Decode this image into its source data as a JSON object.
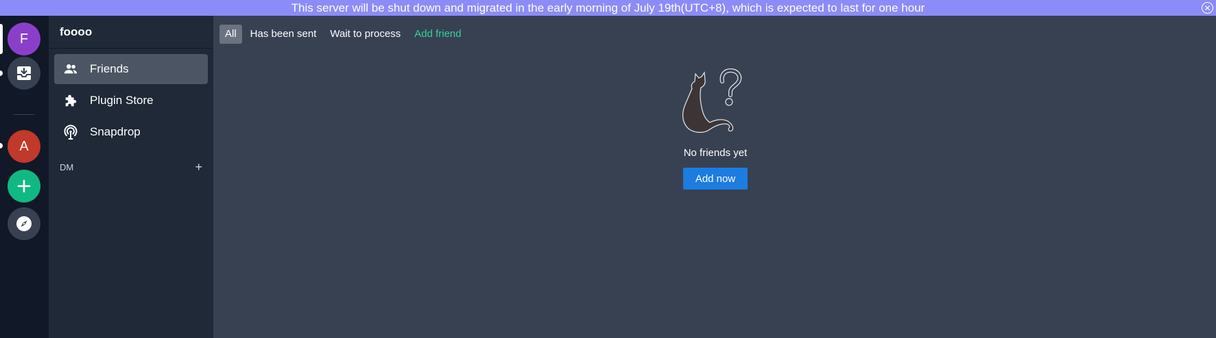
{
  "banner": {
    "message": "This server will be shut down and migrated in the early morning of July 19th(UTC+8), which is expected to last for one hour",
    "close_symbol": "✕"
  },
  "rail": {
    "servers": [
      {
        "letter": "F",
        "color": "#8b3fc9",
        "icon": "server-avatar"
      },
      {
        "icon": "inbox-icon",
        "color": "#374151"
      },
      {
        "letter": "A",
        "color": "#c0392b",
        "icon": "server-avatar"
      },
      {
        "symbol": "+",
        "color": "#10b981",
        "icon": "add-server-icon"
      },
      {
        "icon": "compass-icon",
        "color": "#374151"
      }
    ]
  },
  "sidebar": {
    "title": "foooo",
    "items": [
      {
        "label": "Friends",
        "icon": "friends-icon",
        "active": true
      },
      {
        "label": "Plugin Store",
        "icon": "puzzle-icon",
        "active": false
      },
      {
        "label": "Snapdrop",
        "icon": "broadcast-icon",
        "active": false
      }
    ],
    "dm_label": "DM",
    "dm_add": "+"
  },
  "main": {
    "tabs": [
      {
        "label": "All",
        "active": true
      },
      {
        "label": "Has been sent",
        "active": false
      },
      {
        "label": "Wait to process",
        "active": false
      },
      {
        "label": "Add friend",
        "accent": true
      }
    ],
    "empty_text": "No friends yet",
    "add_now_label": "Add now"
  },
  "colors": {
    "accent_green": "#34d399",
    "primary_button": "#1c7ce0",
    "banner": "#8b8cf7"
  }
}
